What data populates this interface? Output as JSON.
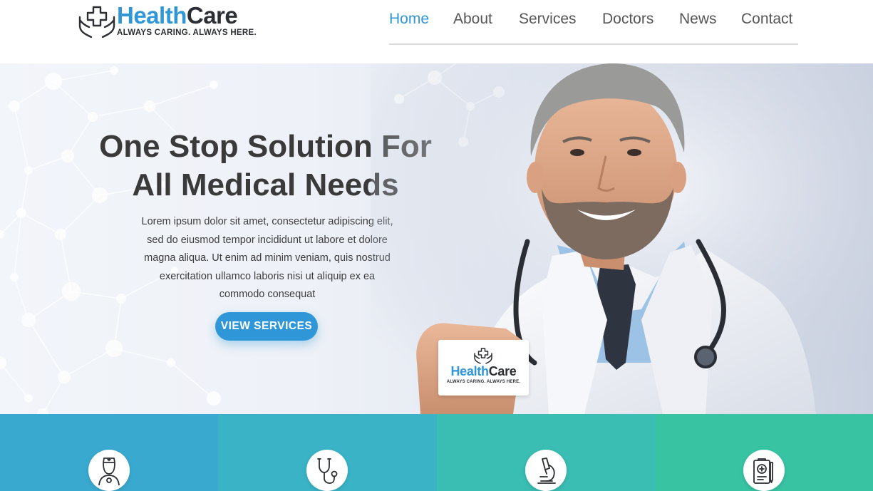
{
  "brand": {
    "name_part1": "Health",
    "name_part2": "Care",
    "tagline": "ALWAYS CARING. ALWAYS HERE.",
    "primary_color": "#2f97d8",
    "dark_color": "#2b2f33",
    "icon": "hands-cross-logo-icon"
  },
  "nav": {
    "items": [
      {
        "label": "Home",
        "active": true
      },
      {
        "label": "About",
        "active": false
      },
      {
        "label": "Services",
        "active": false
      },
      {
        "label": "Doctors",
        "active": false
      },
      {
        "label": "News",
        "active": false
      },
      {
        "label": "Contact",
        "active": false
      }
    ]
  },
  "hero": {
    "title_line1": "One Stop Solution For",
    "title_line2": "All Medical Needs",
    "body_lines": [
      "Lorem ipsum dolor sit amet, consectetur adipiscing elit,",
      "sed do eiusmod tempor incididunt ut labore et dolore",
      "magna aliqua. Ut enim ad minim veniam, quis nostrud",
      "exercitation ullamco laboris nisi ut aliquip ex ea",
      "commodo consequat"
    ],
    "button_label": "VIEW SERVICES",
    "image": "smiling-doctor-holding-card",
    "card": {
      "name_part1": "Health",
      "name_part2": "Care",
      "tagline": "ALWAYS CARING. ALWAYS HERE."
    }
  },
  "features": [
    {
      "icon": "nurse-icon",
      "color": "#3aa9cf"
    },
    {
      "icon": "stethoscope-icon",
      "color": "#3ab3c6"
    },
    {
      "icon": "microscope-icon",
      "color": "#3abdb3"
    },
    {
      "icon": "medical-clipboard-icon",
      "color": "#38c3a3"
    }
  ]
}
